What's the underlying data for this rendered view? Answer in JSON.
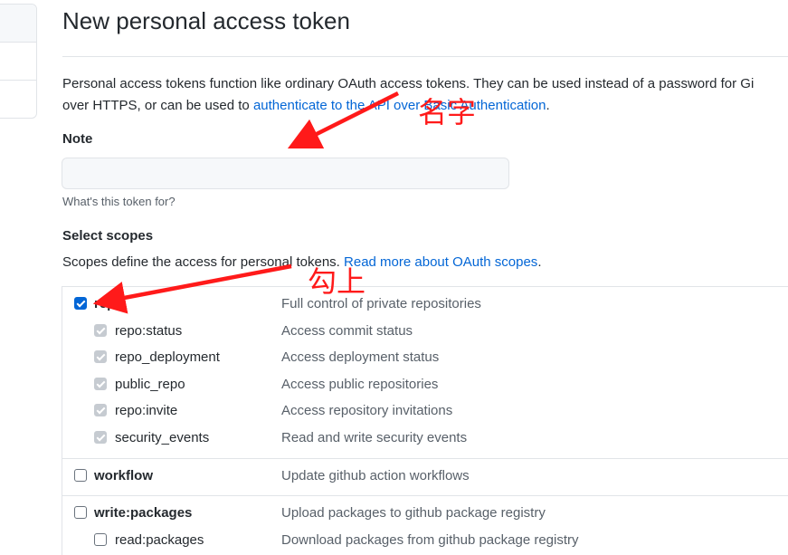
{
  "page": {
    "title": "New personal access token",
    "description_text": "Personal access tokens function like ordinary OAuth access tokens. They can be used instead of a password for Gi",
    "description_line2_prefix": "over HTTPS, or can be used to ",
    "description_link": "authenticate to the API over Basic Authentication",
    "description_line2_suffix": "."
  },
  "note": {
    "label": "Note",
    "value": "",
    "placeholder": "",
    "hint": "What's this token for?"
  },
  "scopes": {
    "label": "Select scopes",
    "desc_prefix": "Scopes define the access for personal tokens. ",
    "desc_link": "Read more about OAuth scopes",
    "desc_suffix": ".",
    "groups": [
      {
        "name": "repo",
        "description": "Full control of private repositories",
        "checked": true,
        "children": [
          {
            "name": "repo:status",
            "description": "Access commit status",
            "state": "checked-disabled"
          },
          {
            "name": "repo_deployment",
            "description": "Access deployment status",
            "state": "checked-disabled"
          },
          {
            "name": "public_repo",
            "description": "Access public repositories",
            "state": "checked-disabled"
          },
          {
            "name": "repo:invite",
            "description": "Access repository invitations",
            "state": "checked-disabled"
          },
          {
            "name": "security_events",
            "description": "Read and write security events",
            "state": "checked-disabled"
          }
        ]
      },
      {
        "name": "workflow",
        "description": "Update github action workflows",
        "checked": false,
        "children": []
      },
      {
        "name": "write:packages",
        "description": "Upload packages to github package registry",
        "checked": false,
        "children": [
          {
            "name": "read:packages",
            "description": "Download packages from github package registry",
            "state": "unchecked"
          }
        ]
      }
    ]
  },
  "annotations": {
    "name_label": "名字",
    "check_label": "勾上",
    "color": "#ff1a1a"
  },
  "colors": {
    "link": "#0366d6",
    "border": "#e1e4e8",
    "muted_text": "#586069"
  }
}
